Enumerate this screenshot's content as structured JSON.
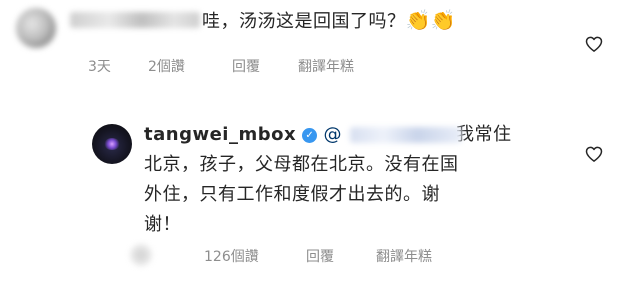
{
  "comment1": {
    "text": "哇，汤汤这是回国了吗？",
    "emojis": "👏👏",
    "time": "3天",
    "likes": "2個讚",
    "reply": "回覆",
    "translate": "翻譯年糕"
  },
  "comment2": {
    "username": "tangwei_mbox",
    "mention_prefix": "@",
    "line1": "我常住",
    "line2": "北京，孩子，父母都在北京。没有在国",
    "line3": "外住，只有工作和度假才出去的。谢",
    "line4": "谢！",
    "likes": "126個讚",
    "reply": "回覆",
    "translate": "翻譯年糕"
  },
  "icons": {
    "verified": "verified-badge-icon",
    "heart": "heart-outline-icon"
  },
  "colors": {
    "text": "#262626",
    "meta": "#8e8e8e",
    "mention": "#00376b",
    "verified": "#3897f0"
  }
}
